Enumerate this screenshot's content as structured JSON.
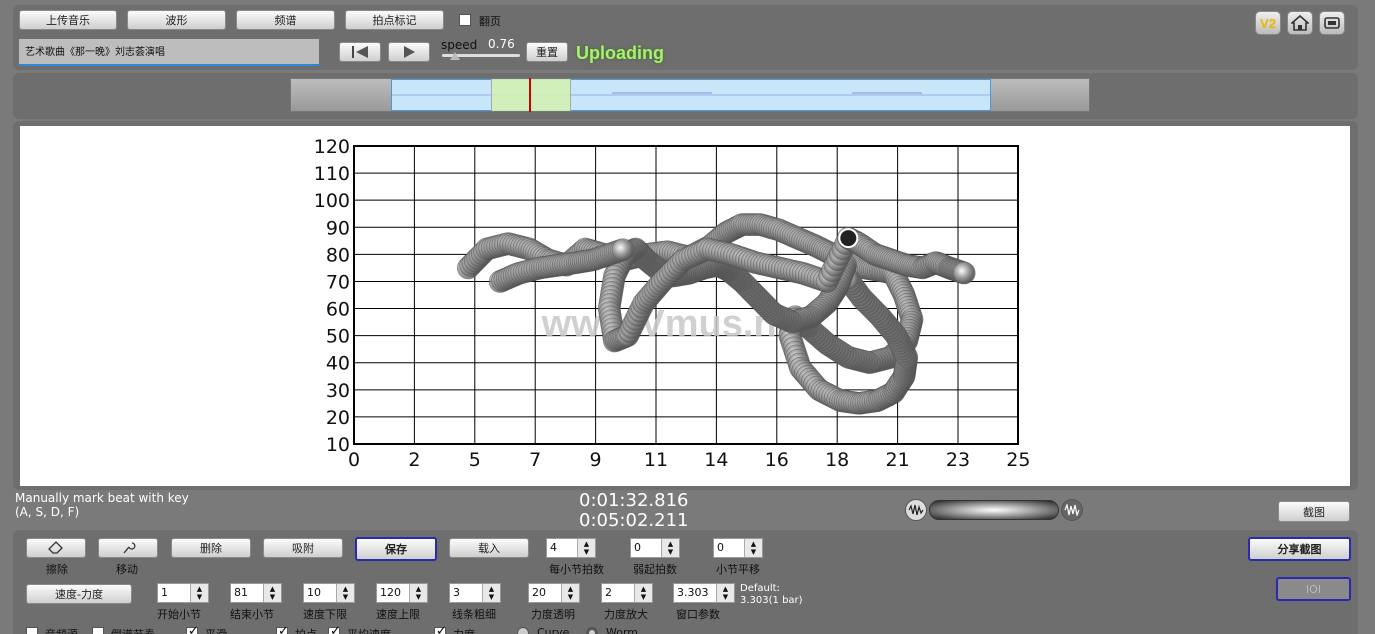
{
  "toolbar": {
    "upload_label": "上传音乐",
    "waveform_label": "波形",
    "spectrum_label": "频谱",
    "beatmark_label": "拍点标记",
    "pageturn_label": "翻页",
    "song_title": "艺术歌曲《那一晚》刘志荟演唱",
    "speed_label": "speed",
    "speed_value": "0.76",
    "reset_label": "重置",
    "status_text": "Uploading",
    "v2_label": "V2"
  },
  "chart_data": {
    "type": "scatter",
    "title": "",
    "xlabel": "",
    "ylabel": "",
    "xlim": [
      0,
      25
    ],
    "ylim": [
      10,
      120
    ],
    "x_ticks": [
      "0",
      "2",
      "5",
      "7",
      "9",
      "11",
      "14",
      "16",
      "18",
      "21",
      "23",
      "25"
    ],
    "y_ticks": [
      "10",
      "20",
      "30",
      "40",
      "50",
      "60",
      "70",
      "80",
      "90",
      "100",
      "110",
      "120"
    ],
    "grid": true,
    "watermark": "www.Vmus.net",
    "series": [
      {
        "x": [
          4.3,
          5.0,
          5.8,
          6.6,
          7.3,
          8.0,
          8.7,
          9.4,
          10.2,
          11.0,
          11.8,
          12.6,
          13.4,
          14.0,
          14.6,
          15.3,
          16.0,
          16.7,
          17.4,
          18.0,
          18.6,
          19.2,
          19.8,
          20.3
        ],
        "y": [
          75,
          82,
          84,
          82,
          78,
          76,
          82,
          80,
          78,
          80,
          81,
          79,
          83,
          88,
          91,
          91,
          89,
          86,
          83,
          80,
          78,
          75,
          74,
          73
        ]
      },
      {
        "x": [
          20.3,
          20.7,
          21.0,
          20.8,
          20.2,
          19.4,
          18.6,
          17.8,
          17.1,
          16.6,
          16.4,
          16.8,
          17.5,
          18.3,
          19.0,
          19.7,
          20.3,
          20.7,
          20.8,
          20.4,
          19.8,
          19.1,
          18.5
        ],
        "y": [
          73,
          65,
          56,
          48,
          42,
          40,
          42,
          47,
          53,
          57,
          50,
          38,
          30,
          26,
          25,
          26,
          29,
          35,
          42,
          50,
          57,
          64,
          72
        ]
      },
      {
        "x": [
          18.5,
          18.2,
          17.8,
          17.2,
          16.5,
          15.8,
          15.2,
          14.6,
          14.1,
          13.7,
          13.2,
          12.6,
          12.0,
          11.5,
          11.0,
          10.6,
          10.2,
          9.8,
          9.6,
          9.8,
          10.3,
          10.9,
          11.6,
          12.4,
          13.3,
          14.2,
          15.1,
          16.0,
          16.9,
          17.8,
          18.6
        ],
        "y": [
          76,
          68,
          62,
          57,
          55,
          58,
          64,
          70,
          74,
          76,
          75,
          73,
          72,
          74,
          78,
          82,
          80,
          72,
          60,
          48,
          50,
          62,
          70,
          78,
          82,
          80,
          77,
          75,
          73,
          70,
          86
        ]
      },
      {
        "x": [
          18.6,
          19.0,
          19.6,
          20.2,
          20.8,
          21.4,
          21.9,
          22.4,
          22.7,
          23.0
        ],
        "y": [
          86,
          84,
          80,
          78,
          76,
          75,
          77,
          75,
          74,
          73
        ]
      },
      {
        "x": [
          5.5,
          6.2,
          7.0,
          7.7,
          8.4,
          9.0,
          9.6,
          10.2
        ],
        "y": [
          70,
          73,
          75,
          76,
          77,
          78,
          80,
          82
        ]
      }
    ]
  },
  "info": {
    "hint_line1": "Manually mark beat with key",
    "hint_line2": "(A, S, D, F)",
    "time_current": "0:01:32.816",
    "time_total": "0:05:02.211",
    "screenshot_label": "截图"
  },
  "controls": {
    "erase_label": "擦除",
    "move_label": "移动",
    "delete_label": "删除",
    "adsorb_label": "吸附",
    "save_label": "保存",
    "load_label": "载入",
    "beats_per_bar_label": "每小节拍数",
    "beats_per_bar_value": "4",
    "upbeat_label": "弱起拍数",
    "upbeat_value": "0",
    "bar_shift_label": "小节平移",
    "bar_shift_value": "0",
    "share_label": "分享截图",
    "ioi_label": "IOI",
    "mode_label": "速度-力度",
    "start_bar_label": "开始小节",
    "start_bar_value": "1",
    "end_bar_label": "结束小节",
    "end_bar_value": "81",
    "tempo_min_label": "速度下限",
    "tempo_min_value": "10",
    "tempo_max_label": "速度上限",
    "tempo_max_value": "120",
    "line_width_label": "线条粗细",
    "line_width_value": "3",
    "dynamic_alpha_label": "力度透明",
    "dynamic_alpha_value": "20",
    "dynamic_zoom_label": "力度放大",
    "dynamic_zoom_value": "2",
    "window_label": "窗口参数",
    "window_value": "3.303",
    "default_line1": "Default:",
    "default_line2": "3.303(1 bar)"
  },
  "bottom_row": {
    "opt1": "音频源",
    "opt2": "倒谱节奏",
    "opt3": "平滑",
    "opt4": "拍点",
    "opt5": "平均速度",
    "opt6": "力度",
    "opt7": "Curve",
    "opt8": "Worm"
  },
  "colors": {
    "status_green": "#a8f070",
    "selection_blue": "#c8e6fa",
    "playhead_red": "#cc0000",
    "worm_gray": "#8a8a8a"
  }
}
